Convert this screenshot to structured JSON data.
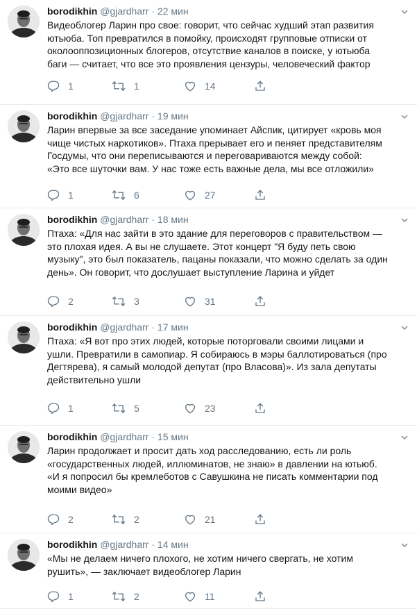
{
  "tweets": [
    {
      "username": "borodikhin",
      "handle": "@gjardharr",
      "separator": "·",
      "time": "22 мин",
      "lines": [
        "Видеоблогер Ларин про свое: говорит, что сейчас худший этап развития",
        "ютьюба. Топ превратился в помойку, происходят групповые отписки от",
        "околооппозиционных блогеров, отсутствие каналов в поиске, у ютьюба",
        "баги — считает, что все это проявления цензуры, человеческий фактор"
      ],
      "replies": "1",
      "retweets": "1",
      "likes": "14"
    },
    {
      "username": "borodikhin",
      "handle": "@gjardharr",
      "separator": "·",
      "time": "19 мин",
      "lines": [
        "Ларин впервые за все заседание упоминает Айспик, цитирует «кровь моя",
        "чище чистых наркотиков». Птаха прерывает его и пеняет представителям",
        "Госдумы, что они переписываются и переговариваются между собой:",
        "«Это все шуточки вам. У нас тоже есть важные дела, мы все отложили»"
      ],
      "replies": "1",
      "retweets": "6",
      "likes": "27"
    },
    {
      "username": "borodikhin",
      "handle": "@gjardharr",
      "separator": "·",
      "time": "18 мин",
      "lines": [
        "Птаха: «Для нас зайти в это здание для переговоров с правительством —",
        "это плохая идея. А вы не слушаете. Этот концерт \"Я буду петь свою",
        "музыку\", это был показатель, пацаны показали, что можно сделать за один",
        "день». Он говорит, что дослушает выступление Ларина и уйдет"
      ],
      "replies": "2",
      "retweets": "3",
      "likes": "31"
    },
    {
      "username": "borodikhin",
      "handle": "@gjardharr",
      "separator": "·",
      "time": "17 мин",
      "lines": [
        "Птаха: «Я вот про этих людей, которые поторговали своими лицами и",
        "ушли. Превратили в самопиар. Я собираюсь в мэры баллотироваться (про",
        "Дегтярева), я самый молодой депутат (про Власова)». Из зала депутаты",
        "действительно ушли"
      ],
      "replies": "1",
      "retweets": "5",
      "likes": "23"
    },
    {
      "username": "borodikhin",
      "handle": "@gjardharr",
      "separator": "·",
      "time": "15 мин",
      "lines": [
        "Ларин продолжает и просит дать ход расследованию, есть ли роль",
        "«государственных людей, иллюминатов, не знаю» в давлении на ютьюб.",
        "«И я попросил бы кремлеботов с Савушкина не писать комментарии под",
        "моими видео»"
      ],
      "replies": "2",
      "retweets": "2",
      "likes": "21"
    },
    {
      "username": "borodikhin",
      "handle": "@gjardharr",
      "separator": "·",
      "time": "14 мин",
      "lines": [
        "«Мы не делаем ничего плохого, не хотим ничего свергать, не хотим",
        "рушить», — заключает видеоблогер Ларин"
      ],
      "replies": "1",
      "retweets": "2",
      "likes": "11"
    }
  ],
  "icons": {
    "avatar": "avatar",
    "reply": "reply-icon",
    "retweet": "retweet-icon",
    "like": "heart-icon",
    "share": "share-icon",
    "menu": "chevron-down-icon"
  },
  "colors": {
    "text": "#14171a",
    "secondary": "#657786",
    "divider": "#e6ecf0"
  }
}
